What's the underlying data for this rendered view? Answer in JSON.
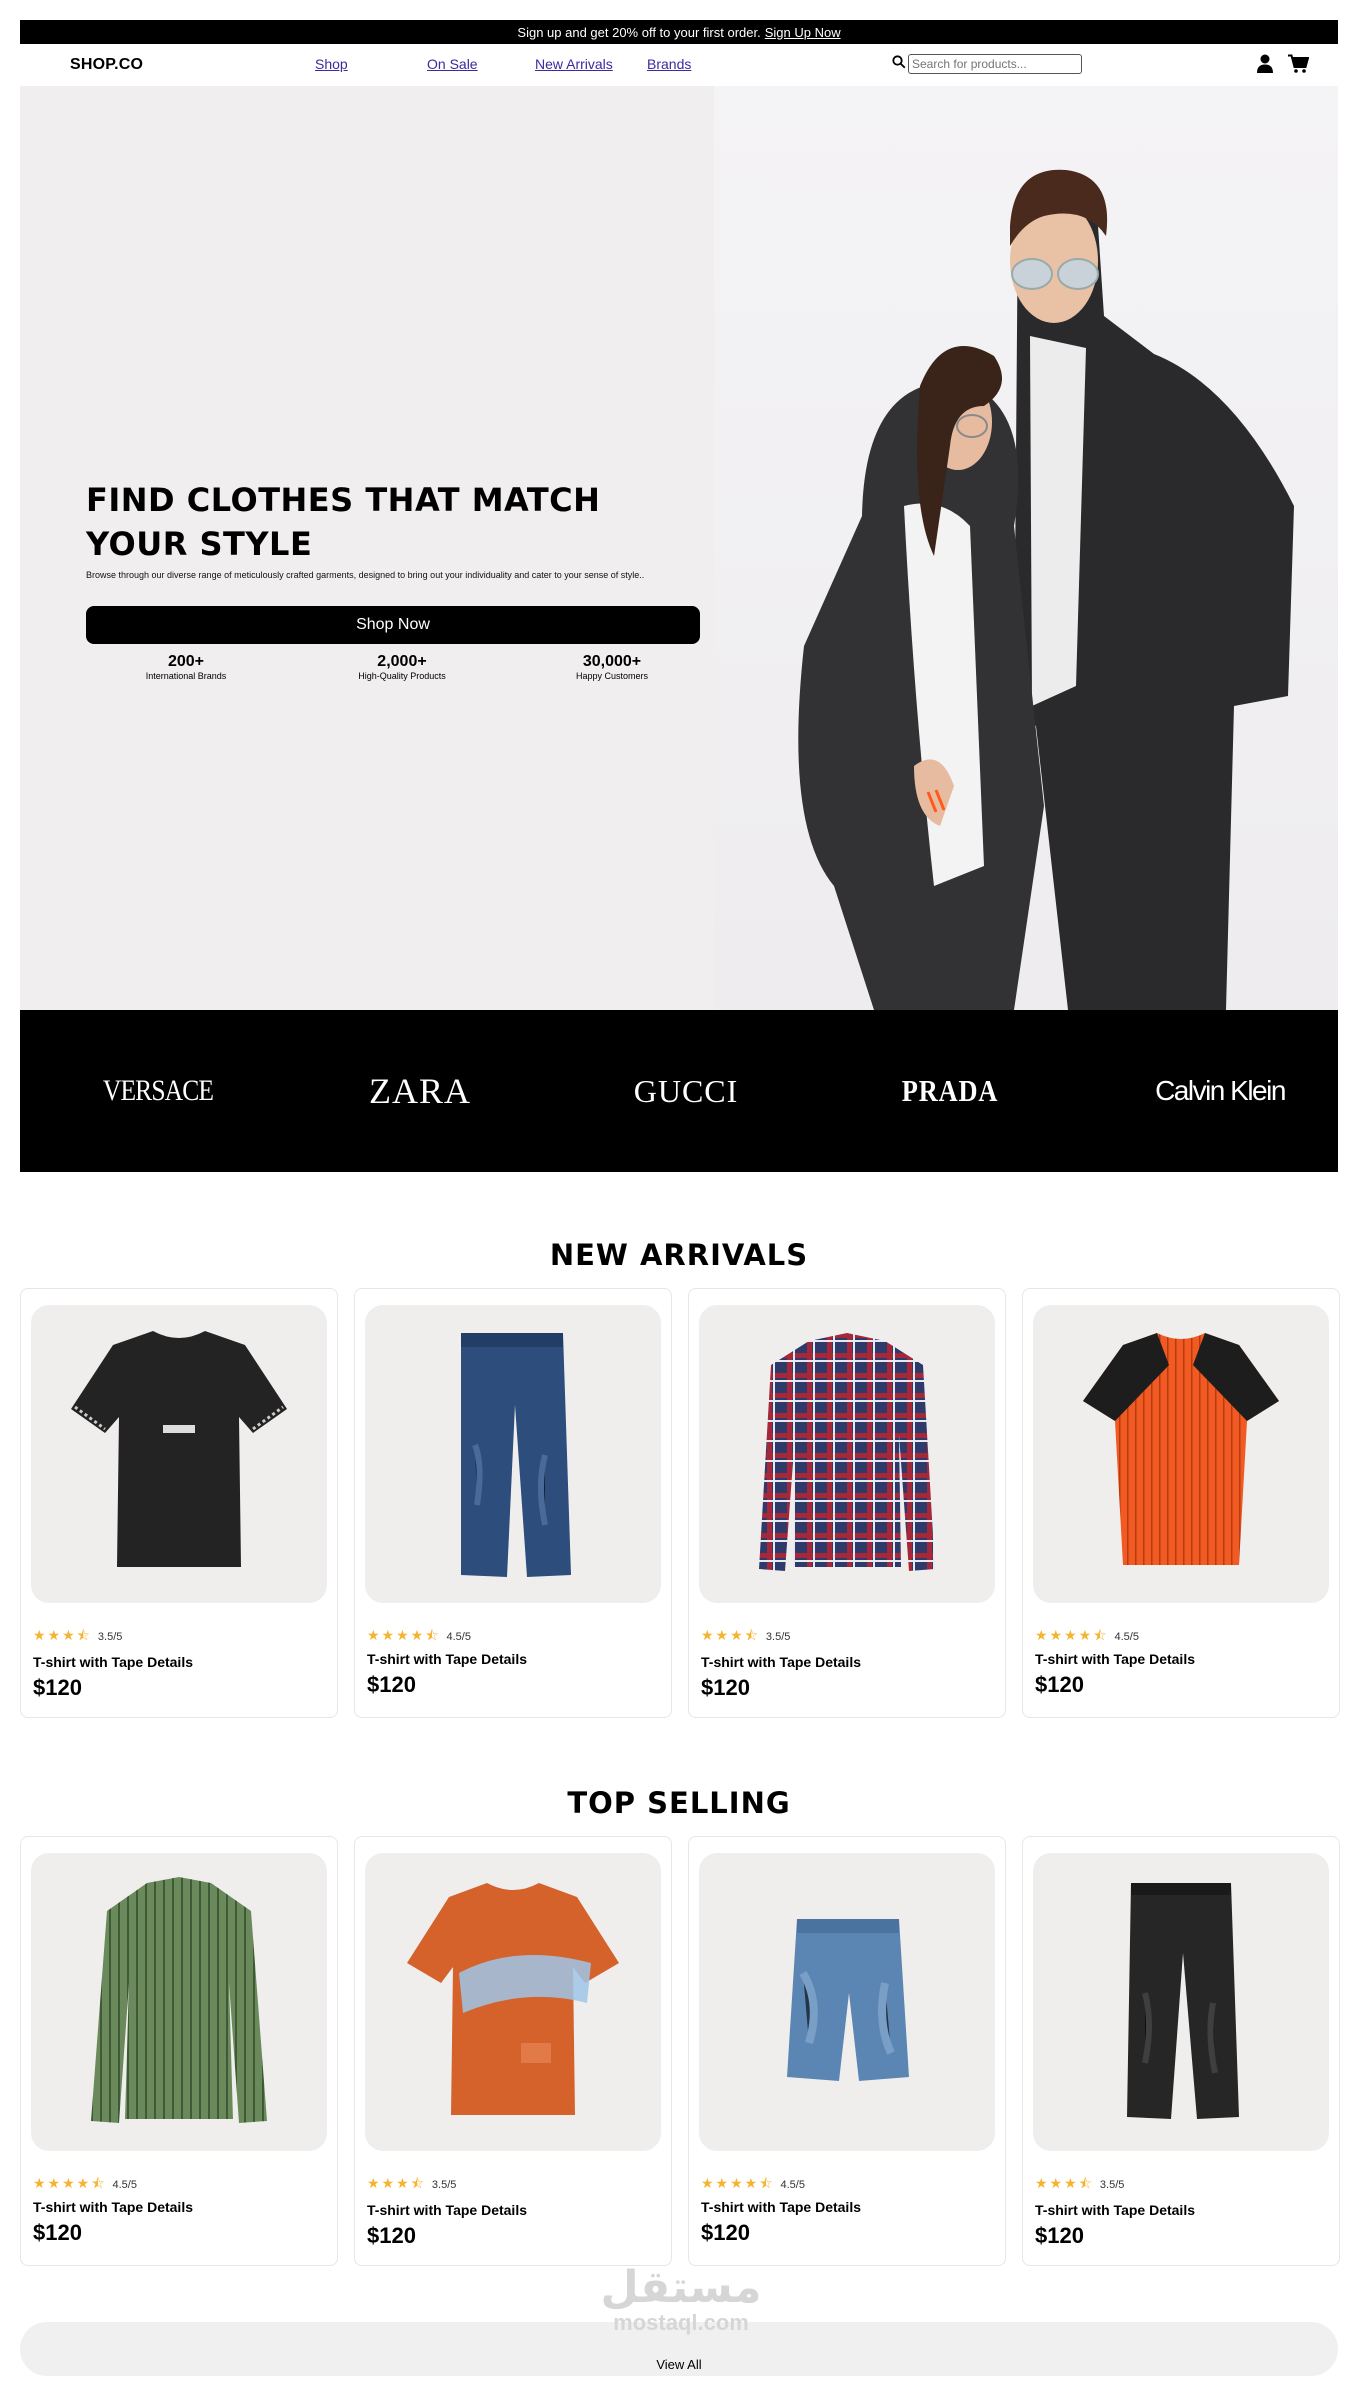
{
  "promo": {
    "text": "Sign up and get 20% off to your first order.",
    "link": "Sign Up Now"
  },
  "header": {
    "logo": "SHOP.CO",
    "nav": [
      "Shop",
      "On Sale",
      "New Arrivals",
      "Brands"
    ],
    "search_placeholder": "Search for products...",
    "icons": [
      "search-icon",
      "user-icon",
      "cart-icon"
    ]
  },
  "hero": {
    "title": "FIND CLOTHES THAT MATCH YOUR STYLE",
    "subtitle": "Browse through our diverse range of meticulously crafted garments, designed to bring out your individuality and cater to your sense of style..",
    "cta": "Shop Now",
    "stats": [
      {
        "value": "200+",
        "label": "International Brands"
      },
      {
        "value": "2,000+",
        "label": "High-Quality Products"
      },
      {
        "value": "30,000+",
        "label": "Happy Customers"
      }
    ]
  },
  "brands": [
    "VERSACE",
    "ZARA",
    "GUCCI",
    "PRADA",
    "Calvin Klein"
  ],
  "new_arrivals": {
    "title": "NEW ARRIVALS",
    "products": [
      {
        "name": "T-shirt with Tape Details",
        "price": "$120",
        "rating": "3.5/5",
        "stars": 3.5,
        "image": "black-tshirt"
      },
      {
        "name": "T-shirt with Tape Details",
        "price": "$120",
        "rating": "4.5/5",
        "stars": 4.5,
        "image": "blue-jeans"
      },
      {
        "name": "T-shirt with Tape Details",
        "price": "$120",
        "rating": "3.5/5",
        "stars": 3.5,
        "image": "plaid-shirt"
      },
      {
        "name": "T-shirt with Tape Details",
        "price": "$120",
        "rating": "4.5/5",
        "stars": 4.5,
        "image": "orange-raglan-tee"
      }
    ]
  },
  "top_selling": {
    "title": "TOP SELLING",
    "products": [
      {
        "name": "T-shirt with Tape Details",
        "price": "$120",
        "rating": "4.5/5",
        "stars": 4.5,
        "image": "green-striped-shirt"
      },
      {
        "name": "T-shirt with Tape Details",
        "price": "$120",
        "rating": "3.5/5",
        "stars": 3.5,
        "image": "orange-graphic-tee"
      },
      {
        "name": "T-shirt with Tape Details",
        "price": "$120",
        "rating": "4.5/5",
        "stars": 4.5,
        "image": "denim-shorts"
      },
      {
        "name": "T-shirt with Tape Details",
        "price": "$120",
        "rating": "3.5/5",
        "stars": 3.5,
        "image": "black-jeans"
      }
    ]
  },
  "view_all": "View All",
  "watermark": {
    "arabic": "مستقل",
    "latin": "mostaql.com"
  },
  "colors": {
    "accent": "#000000",
    "star": "#f5b32f",
    "card_bg": "#f0eeed",
    "nav_link": "#3b2a9e"
  }
}
